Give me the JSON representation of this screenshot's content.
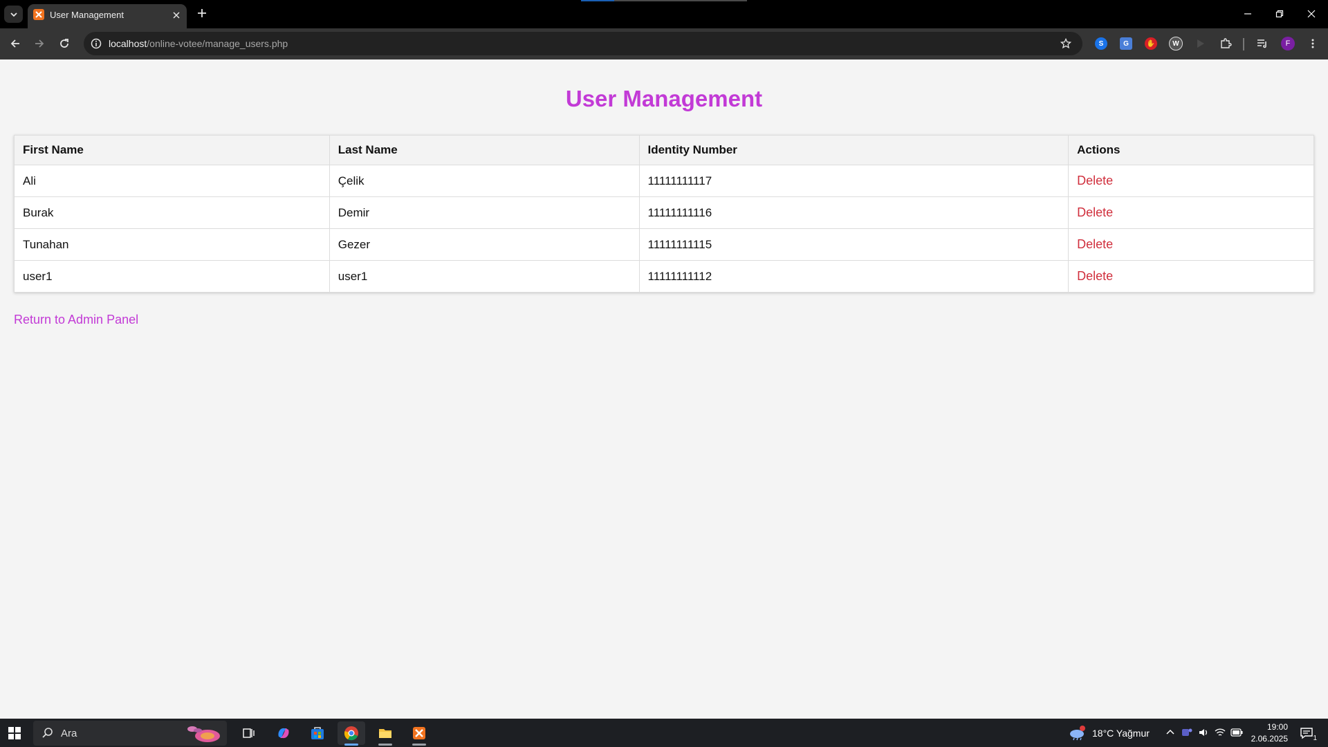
{
  "browser": {
    "tab_title": "User Management",
    "url_host": "localhost",
    "url_path": "/online-votee/manage_users.php",
    "profile_initial": "F"
  },
  "page": {
    "title": "User Management",
    "columns": [
      "First Name",
      "Last Name",
      "Identity Number",
      "Actions"
    ],
    "rows": [
      {
        "first_name": "Ali",
        "last_name": "Çelik",
        "identity_number": "11111111117",
        "action": "Delete"
      },
      {
        "first_name": "Burak",
        "last_name": "Demir",
        "identity_number": "11111111116",
        "action": "Delete"
      },
      {
        "first_name": "Tunahan",
        "last_name": "Gezer",
        "identity_number": "11111111115",
        "action": "Delete"
      },
      {
        "first_name": "user1",
        "last_name": "user1",
        "identity_number": "11111111112",
        "action": "Delete"
      }
    ],
    "back_link": "Return to Admin Panel",
    "accent_color": "#c23ad6",
    "delete_color": "#d02f3d"
  },
  "taskbar": {
    "search_placeholder": "Ara",
    "weather": "18°C  Yağmur",
    "weather_badge": "1",
    "time": "19:00",
    "date": "2.06.2025",
    "notification_count": "1"
  }
}
